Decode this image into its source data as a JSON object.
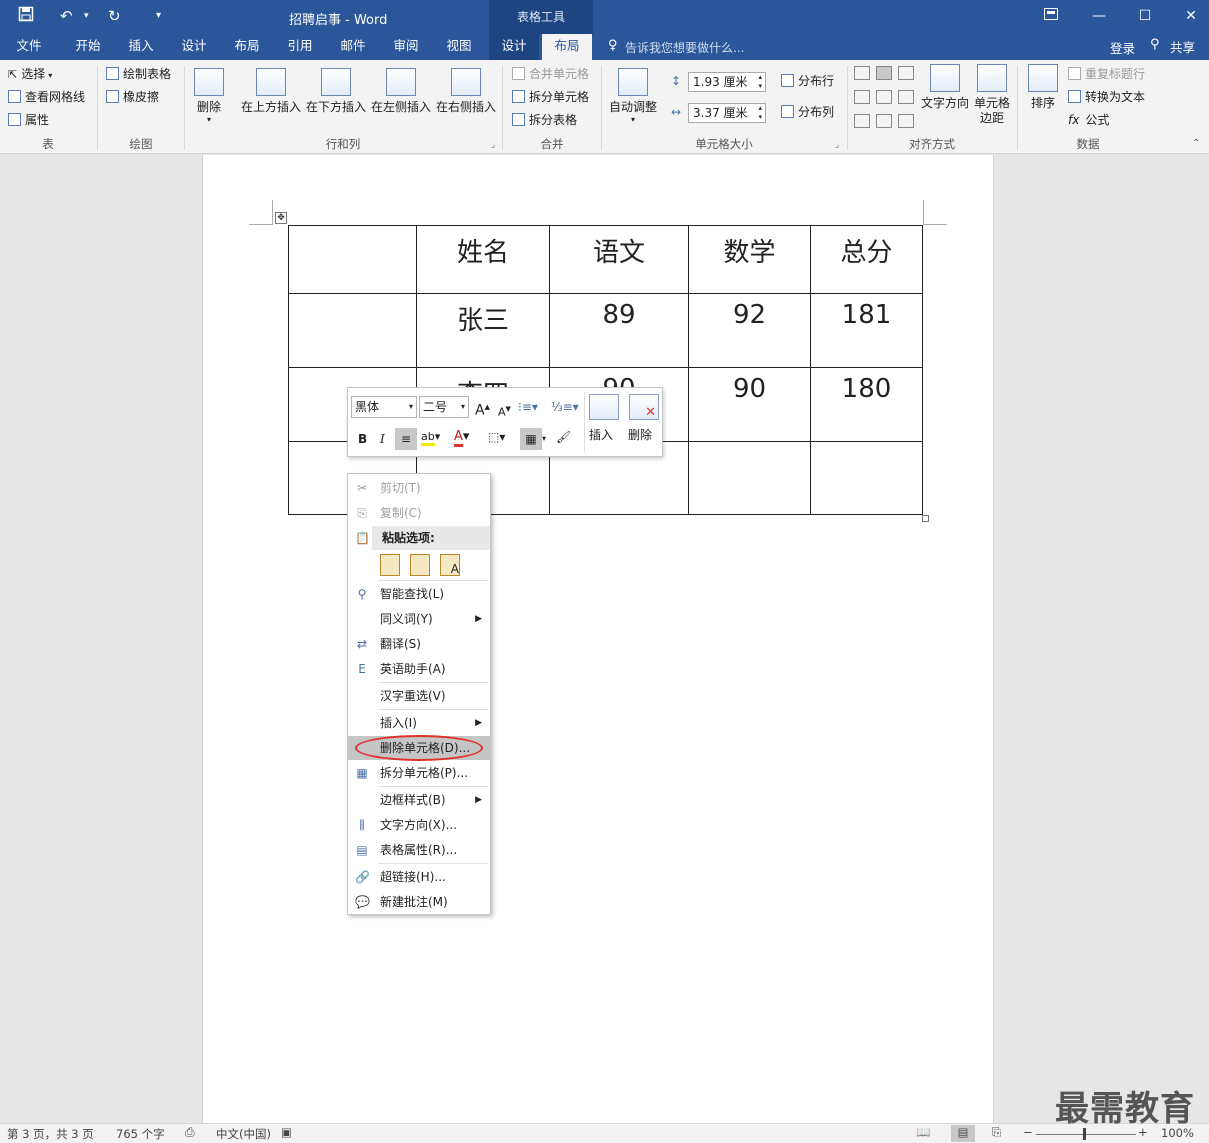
{
  "titlebar": {
    "doc_title": "招聘启事 - Word",
    "context_tools": "表格工具",
    "restore_icon": "ribbon-display-icon",
    "min_glyph": "—",
    "max_glyph": "☐",
    "close_glyph": "✕"
  },
  "tabs": {
    "file": "文件",
    "home": "开始",
    "insert": "插入",
    "design": "设计",
    "layout": "布局",
    "references": "引用",
    "mailings": "邮件",
    "review": "审阅",
    "view": "视图",
    "table_design": "设计",
    "table_layout": "布局",
    "tell_me": "告诉我您想要做什么...",
    "signin": "登录",
    "share": "共享"
  },
  "ribbon": {
    "table": {
      "select": "选择",
      "gridlines": "查看网格线",
      "properties": "属性",
      "label": "表"
    },
    "draw": {
      "draw_table": "绘制表格",
      "eraser": "橡皮擦",
      "label": "绘图"
    },
    "rows_cols": {
      "delete": "删除",
      "insert_above": "在上方插入",
      "insert_below": "在下方插入",
      "insert_left": "在左侧插入",
      "insert_right": "在右侧插入",
      "label": "行和列"
    },
    "merge": {
      "merge_cells": "合并单元格",
      "split_cells": "拆分单元格",
      "split_table": "拆分表格",
      "label": "合并"
    },
    "cell_size": {
      "autofit": "自动调整",
      "height": "1.93 厘米",
      "width": "3.37 厘米",
      "dist_rows": "分布行",
      "dist_cols": "分布列",
      "label": "单元格大小"
    },
    "alignment": {
      "text_direction": "文字方向",
      "cell_margins_l1": "单元格",
      "cell_margins_l2": "边距",
      "label": "对齐方式"
    },
    "data": {
      "sort": "排序",
      "repeat_header": "重复标题行",
      "convert_text": "转换为文本",
      "formula": "公式",
      "label": "数据"
    }
  },
  "table": {
    "rows": [
      [
        "",
        "姓名",
        "语文",
        "数学",
        "总分"
      ],
      [
        "",
        "张三",
        "89",
        "92",
        "181"
      ],
      [
        "",
        "李四",
        "90",
        "90",
        "180"
      ],
      [
        "",
        "",
        "",
        "",
        ""
      ]
    ]
  },
  "mini_toolbar": {
    "font": "黑体",
    "size": "二号",
    "bold": "B",
    "italic": "I",
    "insert": "插入",
    "delete": "删除"
  },
  "context_menu": {
    "cut": "剪切(T)",
    "copy": "复制(C)",
    "paste_options": "粘贴选项:",
    "smart_lookup": "智能查找(L)",
    "synonyms": "同义词(Y)",
    "translate": "翻译(S)",
    "english_assistant": "英语助手(A)",
    "reconvert": "汉字重选(V)",
    "insert": "插入(I)",
    "delete_cells": "删除单元格(D)...",
    "split_cells": "拆分单元格(P)...",
    "border_styles": "边框样式(B)",
    "text_direction": "文字方向(X)...",
    "table_properties": "表格属性(R)...",
    "hyperlink": "超链接(H)...",
    "new_comment": "新建批注(M)"
  },
  "status": {
    "page": "第 3 页，共 3 页",
    "words": "765 个字",
    "language": "中文(中国)",
    "zoom": "100%"
  },
  "watermark": "最需教育",
  "colors": {
    "brand": "#2b579a",
    "highlight_ellipse": "#e03030"
  }
}
